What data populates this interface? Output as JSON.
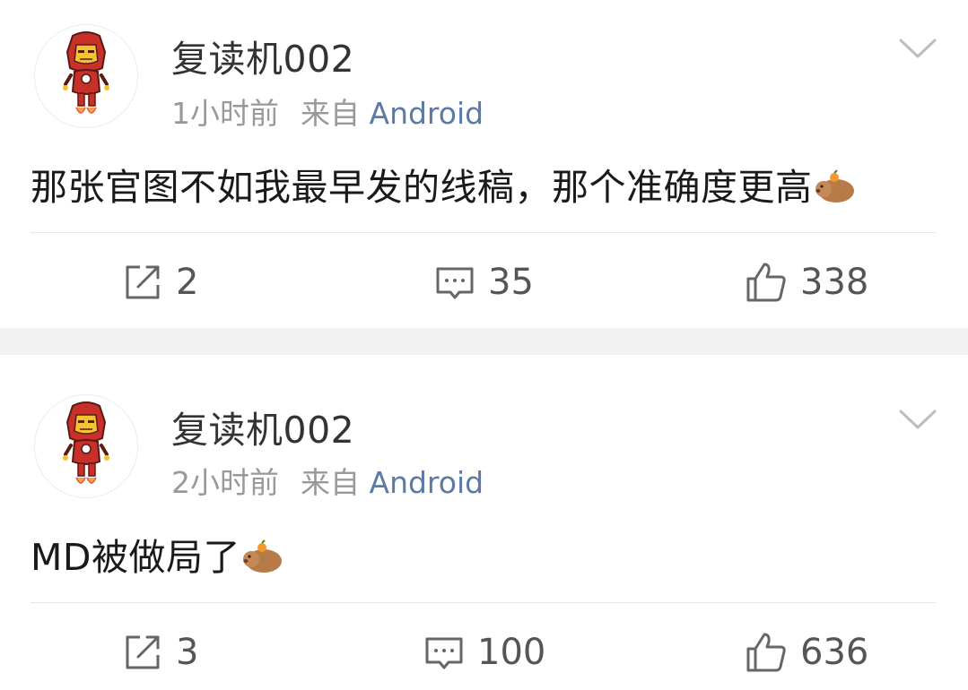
{
  "posts": [
    {
      "username": "复读机002",
      "time": "1小时前",
      "source_prefix": "来自",
      "source_app": "Android",
      "content": "那张官图不如我最早发的线稿，那个准确度更高",
      "emoji": "capybara-emoji",
      "reposts": "2",
      "comments": "35",
      "likes": "338"
    },
    {
      "username": "复读机002",
      "time": "2小时前",
      "source_prefix": "来自",
      "source_app": "Android",
      "content": "MD被做局了",
      "emoji": "capybara-emoji",
      "reposts": "3",
      "comments": "100",
      "likes": "636"
    }
  ],
  "icons": {
    "repost": "repost-icon",
    "comment": "comment-icon",
    "like": "like-icon",
    "menu": "chevron-down-icon",
    "avatar": "iron-man-avatar"
  },
  "colors": {
    "username": "#333333",
    "meta": "#999999",
    "source_link": "#5b7aa5",
    "content": "#1a1a1a",
    "action": "#555555",
    "separator": "#f2f2f2"
  }
}
